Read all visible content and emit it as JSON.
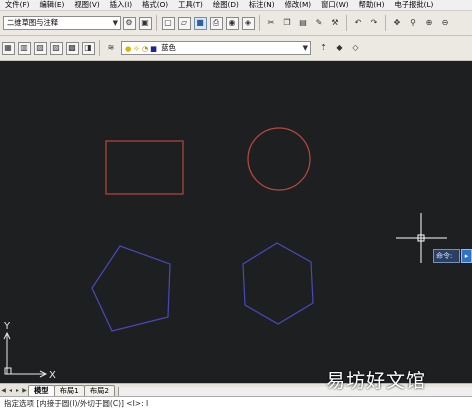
{
  "menu": [
    "文件(F)",
    "编辑(E)",
    "视图(V)",
    "插入(I)",
    "格式(O)",
    "工具(T)",
    "绘图(D)",
    "标注(N)",
    "修改(M)",
    "窗口(W)",
    "帮助(H)",
    "电子报批(L)"
  ],
  "workspace": {
    "value": "二维草图与注释"
  },
  "layer": {
    "name": "蓝色"
  },
  "tabs": [
    "模型",
    "布局1",
    "布局2"
  ],
  "command_line": "指定选项 [内接于圆(I)/外切于圆(C)] <I>: I",
  "command_tip": "命令:",
  "ucs": {
    "x_label": "X",
    "y_label": "Y"
  },
  "watermark": "易坊好文馆",
  "colors": {
    "canvas": "#1e1f21",
    "rectangle": "#b8473f",
    "circle": "#b8473f",
    "pentagon": "#4a49b8",
    "hexagon": "#4a49b8",
    "crosshair": "#ffffff"
  },
  "icons": {
    "toolbar1": [
      "qnew-icon",
      "open-icon",
      "save-icon",
      "plot-icon",
      "preview-icon",
      "publish-icon",
      "cut-icon",
      "copy-icon",
      "paste-icon",
      "matchprop-icon",
      "undo-icon",
      "redo-icon",
      "pan-icon",
      "zoom-icon",
      "zoom-window-icon",
      "zoom-previous-icon"
    ],
    "toolbar2": [
      "layer-manager-icon",
      "layer-state-icon",
      "layer-previous-icon",
      "layer-isolate-icon",
      "layer-freeze-icon",
      "layer-lock-icon"
    ]
  }
}
